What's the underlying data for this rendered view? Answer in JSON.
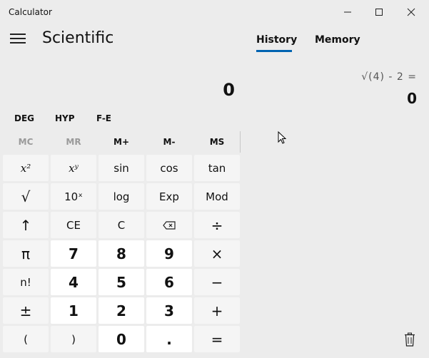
{
  "window": {
    "title": "Calculator",
    "minimize_icon": "minimize-icon",
    "maximize_icon": "maximize-icon",
    "close_icon": "close-icon"
  },
  "header": {
    "menu_icon": "hamburger-menu-icon",
    "mode_title": "Scientific"
  },
  "tabs": [
    {
      "label": "History",
      "active": true
    },
    {
      "label": "Memory",
      "active": false
    }
  ],
  "colors": {
    "accent": "#0063b1",
    "background": "#ececec",
    "number_key": "#ffffff",
    "function_key": "#f5f5f5"
  },
  "display": {
    "value": "0"
  },
  "mode_buttons": [
    "DEG",
    "HYP",
    "F-E"
  ],
  "memory": [
    {
      "label": "MC",
      "enabled": false
    },
    {
      "label": "MR",
      "enabled": false
    },
    {
      "label": "M+",
      "enabled": true
    },
    {
      "label": "M-",
      "enabled": true
    },
    {
      "label": "MS",
      "enabled": true
    }
  ],
  "keys": [
    [
      "x²",
      "xʸ",
      "sin",
      "cos",
      "tan"
    ],
    [
      "√",
      "10ˣ",
      "log",
      "Exp",
      "Mod"
    ],
    [
      "↑",
      "CE",
      "C",
      "⌫",
      "÷"
    ],
    [
      "π",
      "7",
      "8",
      "9",
      "×"
    ],
    [
      "n!",
      "4",
      "5",
      "6",
      "−"
    ],
    [
      "±",
      "1",
      "2",
      "3",
      "+"
    ],
    [
      "(",
      ")",
      "0",
      ".",
      "="
    ]
  ],
  "history": {
    "expression": "√(4)  -  2 =",
    "result": "0",
    "delete_icon": "trash-icon"
  }
}
